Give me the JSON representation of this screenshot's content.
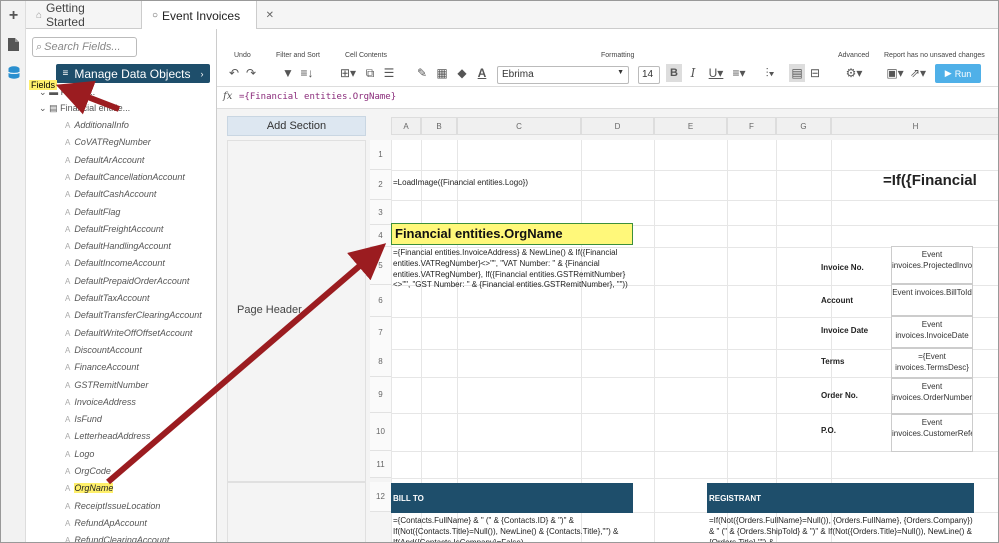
{
  "tabs": [
    {
      "label": "Getting Started",
      "icon": "home-icon"
    },
    {
      "label": "Event Invoices",
      "icon": "report-icon",
      "close": "✕"
    }
  ],
  "search": {
    "placeholder": "Search Fields..."
  },
  "manage_button": "Manage Data Objects",
  "fields_label": "Fields",
  "tree": {
    "root": "Financ...",
    "financial": "Financial entitie...",
    "items": [
      "AdditionalInfo",
      "CoVATRegNumber",
      "DefaultArAccount",
      "DefaultCancellationAccount",
      "DefaultCashAccount",
      "DefaultFlag",
      "DefaultFreightAccount",
      "DefaultHandlingAccount",
      "DefaultIncomeAccount",
      "DefaultPrepaidOrderAccount",
      "DefaultTaxAccount",
      "DefaultTransferClearingAccount",
      "DefaultWriteOffOffsetAccount",
      "DiscountAccount",
      "FinanceAccount",
      "GSTRemitNumber",
      "InvoiceAddress",
      "IsFund",
      "LetterheadAddress",
      "Logo",
      "OrgCode",
      "OrgName",
      "ReceiptIssueLocation",
      "RefundApAccount",
      "RefundClearingAccount"
    ],
    "highlighted": "OrgName"
  },
  "ribbon": {
    "undo": "Undo",
    "filter": "Filter and Sort",
    "cell_contents": "Cell Contents",
    "formatting": "Formatting",
    "advanced": "Advanced",
    "report_status": "Report has no unsaved changes",
    "font": "Ebrima",
    "font_size": "14",
    "run": "Run"
  },
  "formula": "={Financial entities.OrgName}",
  "add_section": "Add Section",
  "page_header": "Page Header",
  "columns": [
    "A",
    "B",
    "C",
    "D",
    "E",
    "F",
    "G",
    "H"
  ],
  "rows": [
    "1",
    "2",
    "3",
    "4",
    "5",
    "6",
    "7",
    "8",
    "9",
    "10",
    "11",
    "12"
  ],
  "cells": {
    "logo": "=LoadImage({Financial entities.Logo})",
    "if_header": "=If({Financial",
    "orgname": "Financial entities.OrgName",
    "address": "={Financial entities.InvoiceAddress} & NewLine() & If({Financial entities.VATRegNumber}<>\"\", \"VAT Number: \" & {Financial entities.VATRegNumber}, If({Financial entities.GSTRemitNumber}<>\"\", \"GST Number: \" & {Financial entities.GSTRemitNumber}, \"\"))",
    "labels": [
      "Invoice No.",
      "Account",
      "Invoice Date",
      "Terms",
      "Order No.",
      "P.O."
    ],
    "values": [
      "Event invoices.ProjectedInvoiceNumber",
      "Event invoices.BillToId",
      "Event invoices.InvoiceDate",
      "={Event invoices.TermsDesc}",
      "Event invoices.OrderNumber",
      "Event invoices.CustomerReference"
    ],
    "bill_to": "BILL TO",
    "registrant": "REGISTRANT",
    "bill_formula": "={Contacts.FullName} & \" (\" & {Contacts.ID} & \")\" & If(Not({Contacts.Title}=Null()), NewLine() & {Contacts.Title},\"\") & If(And({Contacts.IsCompany}=False)",
    "reg_formula": "=If(Not({Orders.FullName}=Null()), {Orders.FullName}, {Orders.Company}) & \" (\" & {Orders.ShipToId} & \")\" & If(Not({Orders.Title}=Null()), NewLine() & {Orders.Title},\"\") &"
  },
  "colors": {
    "accent": "#1e4e6b",
    "highlight": "#fff87a",
    "arrow": "#9b1c20",
    "run": "#4fb0e8"
  }
}
